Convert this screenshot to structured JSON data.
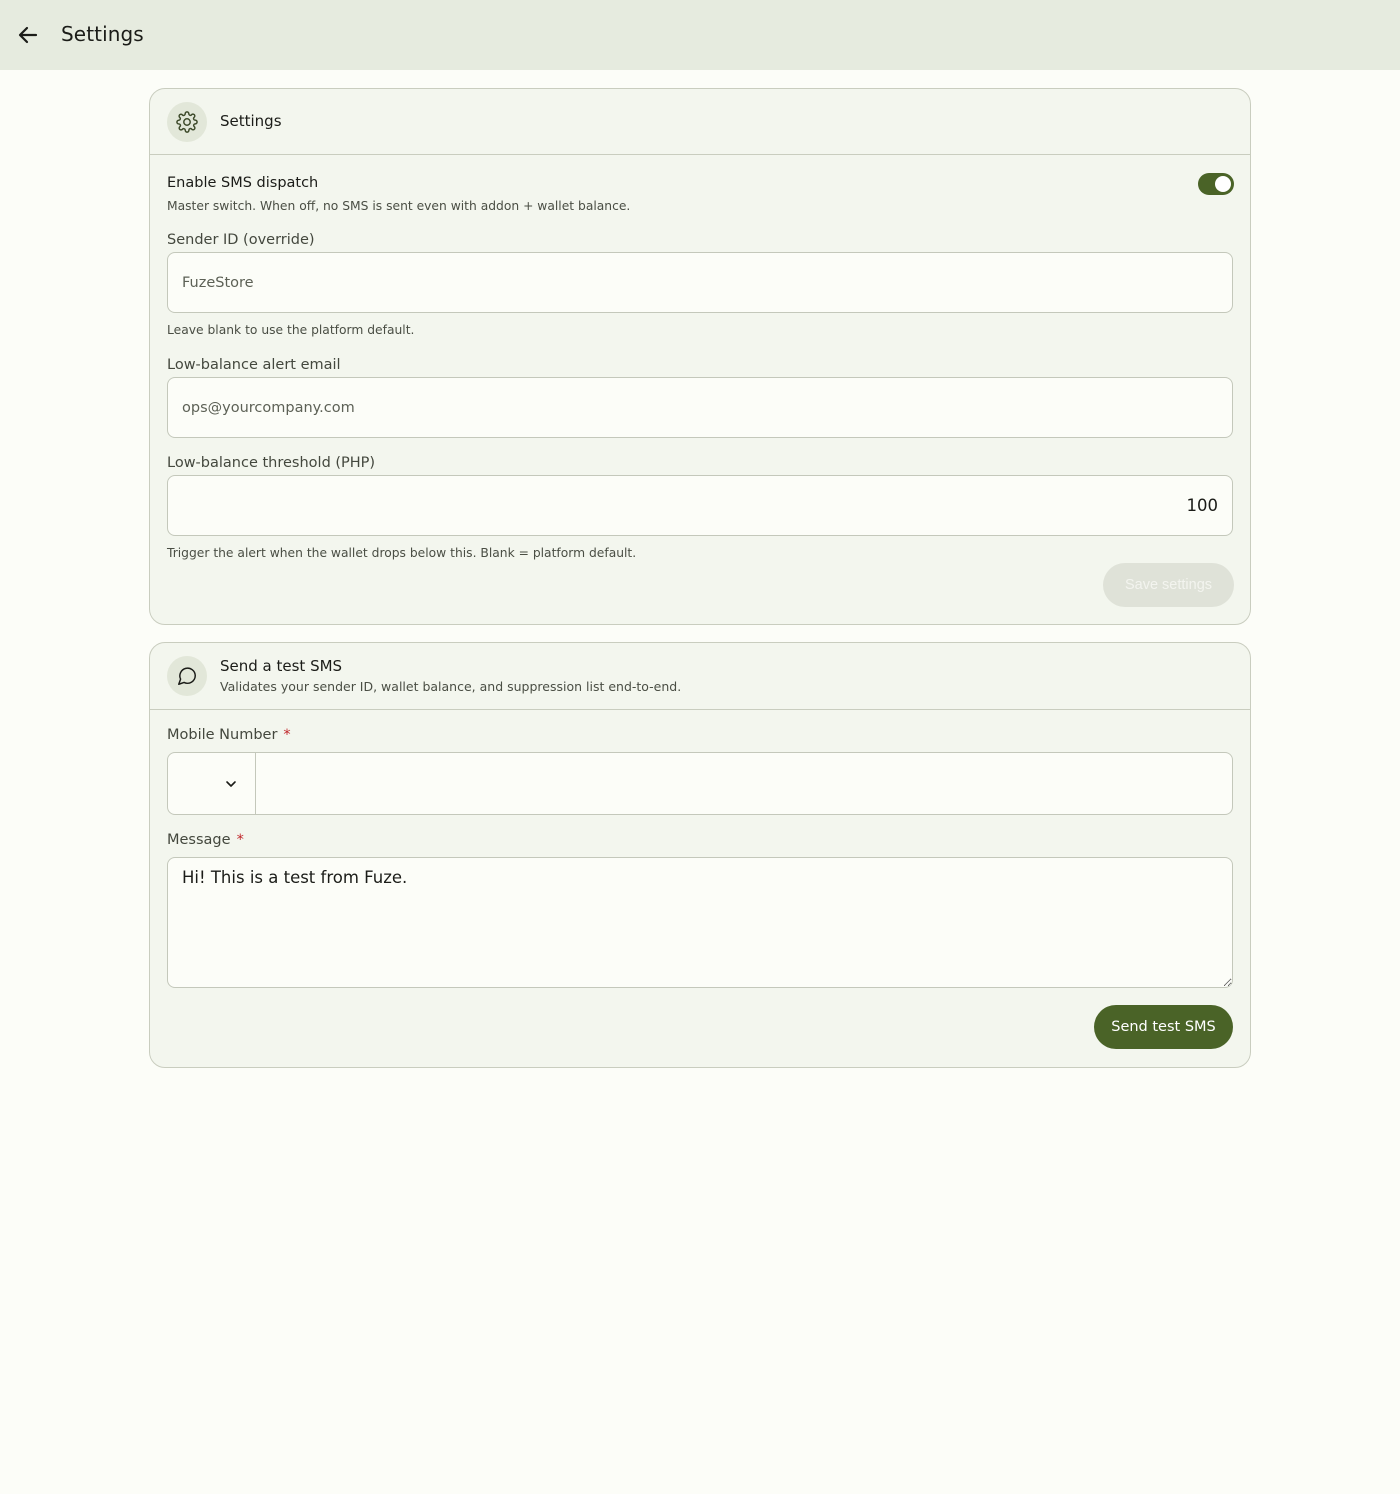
{
  "topbar": {
    "title": "Settings",
    "back_icon": "arrow-left-icon"
  },
  "settings_card": {
    "icon": "gear-icon",
    "title": "Settings",
    "sms_dispatch": {
      "label": "Enable SMS dispatch",
      "help": "Master switch. When off, no SMS is sent even with addon + wallet balance.",
      "enabled": true
    },
    "sender_id": {
      "label": "Sender ID (override)",
      "placeholder": "FuzeStore",
      "value": "",
      "help": "Leave blank to use the platform default."
    },
    "alert_email": {
      "label": "Low-balance alert email",
      "placeholder": "ops@yourcompany.com",
      "value": ""
    },
    "threshold": {
      "label": "Low-balance threshold (PHP)",
      "value": "100",
      "help": "Trigger the alert when the wallet drops below this. Blank = platform default."
    },
    "save_label": "Save settings"
  },
  "test_card": {
    "icon": "chat-bubble-icon",
    "title": "Send a test SMS",
    "subtitle": "Validates your sender ID, wallet balance, and suppression list end-to-end.",
    "mobile": {
      "label": "Mobile Number",
      "required_mark": "*",
      "country_value": "",
      "value": ""
    },
    "message": {
      "label": "Message",
      "required_mark": "*",
      "value": "Hi! This is a test from Fuze."
    },
    "send_label": "Send test SMS"
  },
  "colors": {
    "accent": "#4a6327",
    "topbar_bg": "#e6ebdf",
    "card_bg": "#f3f6ee",
    "required": "#c0262a"
  }
}
